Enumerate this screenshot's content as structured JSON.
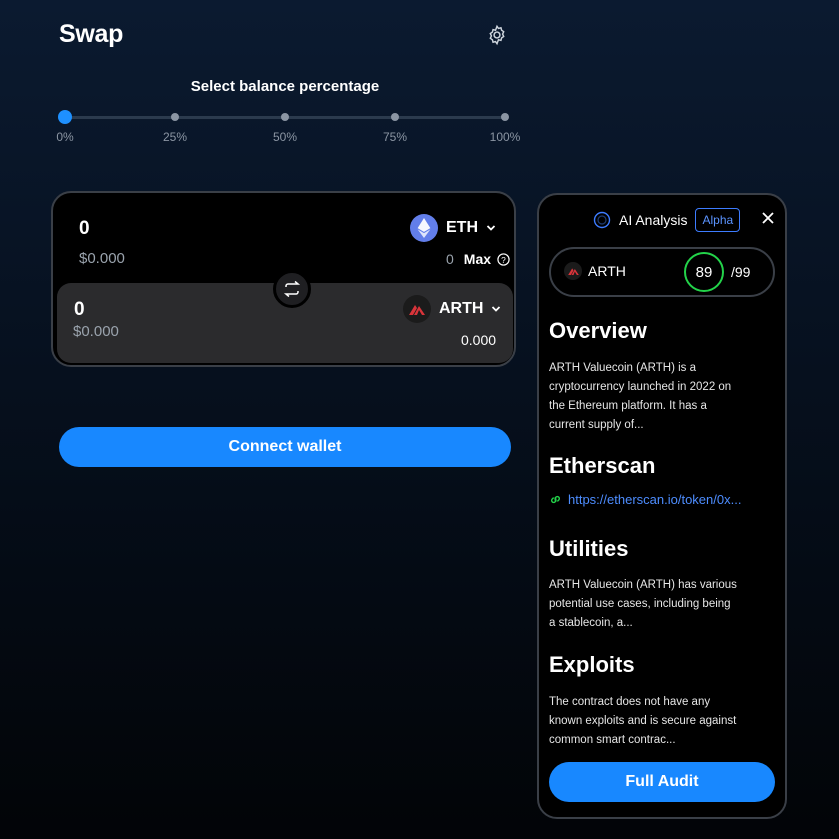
{
  "header": {
    "title": "Swap",
    "settings_icon": "gear-icon"
  },
  "slider": {
    "title": "Select balance percentage",
    "value_percent": 0,
    "labels": [
      "0%",
      "25%",
      "50%",
      "75%",
      "100%"
    ]
  },
  "swap": {
    "from": {
      "amount": "0",
      "usd": "$0.000",
      "token": "ETH",
      "balance": "0",
      "max_label": "Max"
    },
    "to": {
      "amount": "0",
      "usd": "$0.000",
      "token": "ARTH",
      "balance": "0.000"
    }
  },
  "connect_wallet": "Connect wallet",
  "ai": {
    "title": "AI Analysis",
    "badge": "Alpha",
    "token": "ARTH",
    "score": "89",
    "score_max": "/99",
    "sections": {
      "overview_title": "Overview",
      "overview_text": "ARTH Valuecoin (ARTH) is a cryptocurrency launched in 2022 on the Ethereum platform. It has a current supply of...",
      "etherscan_title": "Etherscan",
      "etherscan_link": "https://etherscan.io/token/0x...",
      "utilities_title": "Utilities",
      "utilities_text": "ARTH Valuecoin (ARTH) has various potential use cases, including being a stablecoin, a...",
      "exploits_title": "Exploits",
      "exploits_text": "The contract does not have any known exploits and is secure against common smart contrac..."
    },
    "audit_button": "Full Audit"
  },
  "colors": {
    "accent": "#1888ff",
    "score_ring": "#23d34a",
    "alpha": "#3d7cff"
  }
}
